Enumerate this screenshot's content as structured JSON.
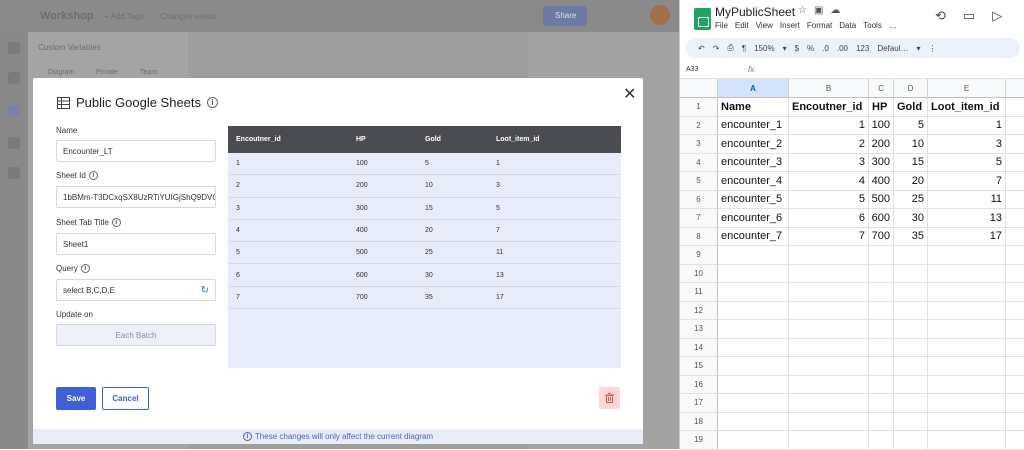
{
  "background_app": {
    "title": "Workshop",
    "add_tags": "+ Add Tags",
    "changes_saved": "Changes saved",
    "share_label": "Share",
    "panel_title": "Custom Variables",
    "panel_tabs": [
      "Diagram",
      "Private",
      "Team"
    ]
  },
  "modal": {
    "title": "Public Google Sheets",
    "close_label": "✕",
    "name_label": "Name",
    "name_value": "Encounter_LT",
    "sheet_id_label": "Sheet Id",
    "sheet_id_value": "1bBMm-T3DCxqSX8UzRTiYUIGjShQ9DVO",
    "tab_title_label": "Sheet Tab Title",
    "tab_title_value": "Sheet1",
    "query_label": "Query",
    "query_value": "select B,C,D,E",
    "update_on_label": "Update on",
    "update_on_value": "Each Batch",
    "save_label": "Save",
    "cancel_label": "Cancel",
    "footer_note": "These changes will only affect the current diagram",
    "table": {
      "headers": [
        "Encoutner_id",
        "HP",
        "Gold",
        "Loot_item_id"
      ],
      "rows": [
        [
          "1",
          "100",
          "5",
          "1"
        ],
        [
          "2",
          "200",
          "10",
          "3"
        ],
        [
          "3",
          "300",
          "15",
          "5"
        ],
        [
          "4",
          "400",
          "20",
          "7"
        ],
        [
          "5",
          "500",
          "25",
          "11"
        ],
        [
          "6",
          "600",
          "30",
          "13"
        ],
        [
          "7",
          "700",
          "35",
          "17"
        ]
      ]
    }
  },
  "sheets": {
    "doc_title": "MyPublicSheet",
    "menu": [
      "File",
      "Edit",
      "View",
      "Insert",
      "Format",
      "Data",
      "Tools",
      "…"
    ],
    "zoom": "150%",
    "font": "Defaul…",
    "toolbar_items": [
      "$",
      "%",
      ".0",
      ".00",
      "123"
    ],
    "name_box": "A33",
    "fx": "fx",
    "columns": [
      "A",
      "B",
      "C",
      "D",
      "E"
    ],
    "row_numbers": [
      "1",
      "2",
      "3",
      "4",
      "5",
      "6",
      "7",
      "8",
      "9",
      "10",
      "11",
      "12",
      "13",
      "14",
      "15",
      "16",
      "17",
      "18",
      "19"
    ],
    "header_row": [
      "Name",
      "Encoutner_id",
      "HP",
      "Gold",
      "Loot_item_id"
    ],
    "rows": [
      [
        "encounter_1",
        "1",
        "100",
        "5",
        "1"
      ],
      [
        "encounter_2",
        "2",
        "200",
        "10",
        "3"
      ],
      [
        "encounter_3",
        "3",
        "300",
        "15",
        "5"
      ],
      [
        "encounter_4",
        "4",
        "400",
        "20",
        "7"
      ],
      [
        "encounter_5",
        "5",
        "500",
        "25",
        "11"
      ],
      [
        "encounter_6",
        "6",
        "600",
        "30",
        "13"
      ],
      [
        "encounter_7",
        "7",
        "700",
        "35",
        "17"
      ]
    ]
  }
}
